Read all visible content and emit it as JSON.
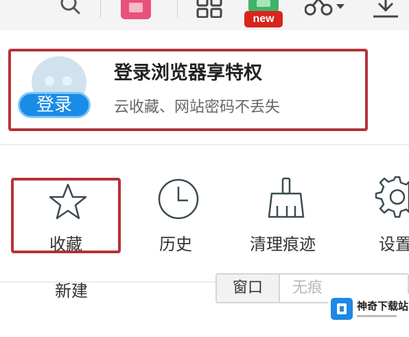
{
  "toolbar": {
    "items": [
      {
        "name": "search-icon"
      },
      {
        "name": "shopping-icon"
      },
      {
        "name": "apps-grid-icon"
      },
      {
        "name": "game-icon"
      },
      {
        "name": "scissors-dropdown-icon"
      },
      {
        "name": "download-icon"
      }
    ],
    "new_badge": "new"
  },
  "login": {
    "button_label": "登录",
    "title": "登录浏览器享特权",
    "subtitle": "云收藏、网站密码不丢失"
  },
  "quick_actions": [
    {
      "icon": "star-icon",
      "label": "收藏"
    },
    {
      "icon": "clock-icon",
      "label": "历史"
    },
    {
      "icon": "broom-icon",
      "label": "清理痕迹"
    },
    {
      "icon": "gear-icon",
      "label": "设置"
    }
  ],
  "new_section": {
    "label": "新建",
    "options": [
      "窗口",
      "无痕"
    ]
  },
  "watermark": {
    "text": "神奇下载站"
  },
  "colors": {
    "highlight_border": "#b5323a",
    "login_blue": "#1a8be6",
    "new_badge_red": "#d8251e"
  }
}
